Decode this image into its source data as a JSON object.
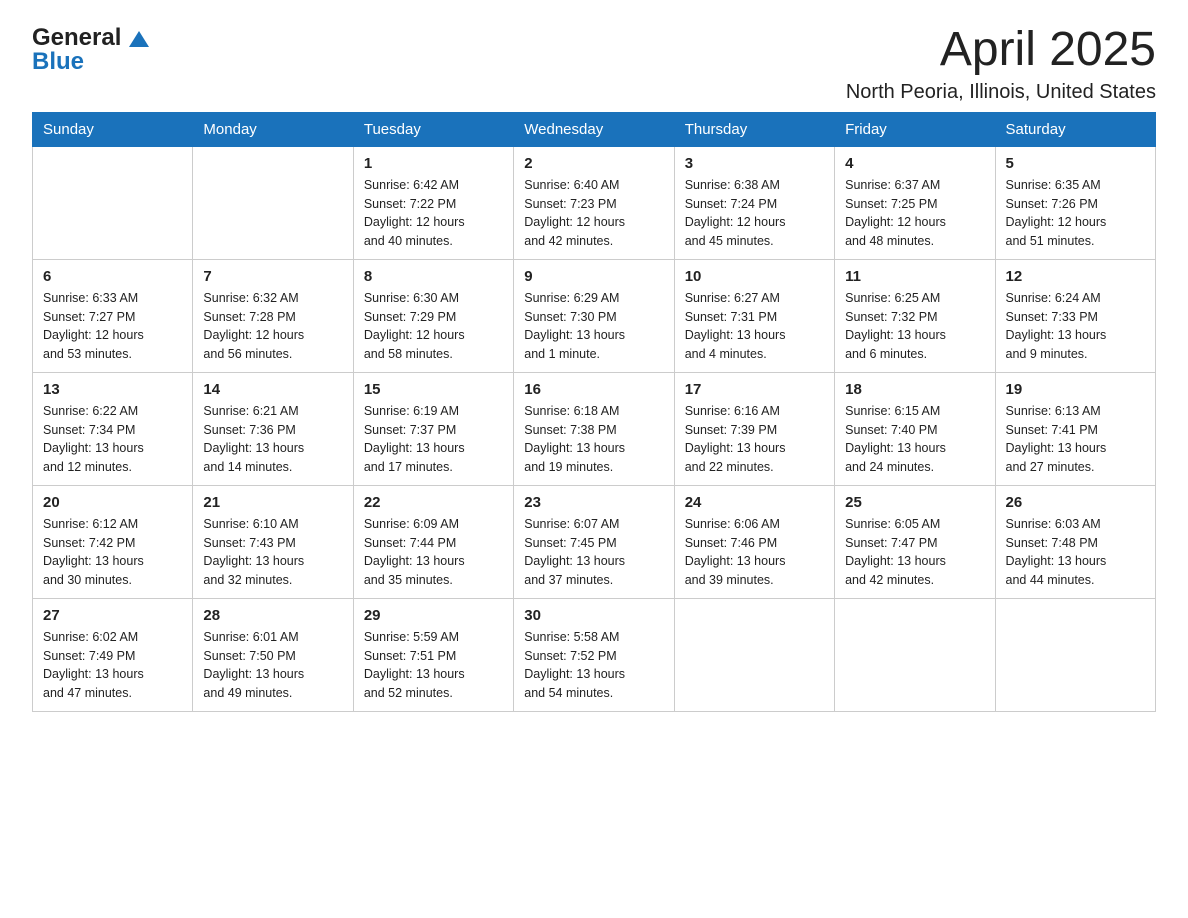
{
  "header": {
    "logo_text_general": "General",
    "logo_text_blue": "Blue",
    "month_title": "April 2025",
    "location": "North Peoria, Illinois, United States"
  },
  "calendar": {
    "days_of_week": [
      "Sunday",
      "Monday",
      "Tuesday",
      "Wednesday",
      "Thursday",
      "Friday",
      "Saturday"
    ],
    "weeks": [
      [
        {
          "day": "",
          "info": ""
        },
        {
          "day": "",
          "info": ""
        },
        {
          "day": "1",
          "info": "Sunrise: 6:42 AM\nSunset: 7:22 PM\nDaylight: 12 hours\nand 40 minutes."
        },
        {
          "day": "2",
          "info": "Sunrise: 6:40 AM\nSunset: 7:23 PM\nDaylight: 12 hours\nand 42 minutes."
        },
        {
          "day": "3",
          "info": "Sunrise: 6:38 AM\nSunset: 7:24 PM\nDaylight: 12 hours\nand 45 minutes."
        },
        {
          "day": "4",
          "info": "Sunrise: 6:37 AM\nSunset: 7:25 PM\nDaylight: 12 hours\nand 48 minutes."
        },
        {
          "day": "5",
          "info": "Sunrise: 6:35 AM\nSunset: 7:26 PM\nDaylight: 12 hours\nand 51 minutes."
        }
      ],
      [
        {
          "day": "6",
          "info": "Sunrise: 6:33 AM\nSunset: 7:27 PM\nDaylight: 12 hours\nand 53 minutes."
        },
        {
          "day": "7",
          "info": "Sunrise: 6:32 AM\nSunset: 7:28 PM\nDaylight: 12 hours\nand 56 minutes."
        },
        {
          "day": "8",
          "info": "Sunrise: 6:30 AM\nSunset: 7:29 PM\nDaylight: 12 hours\nand 58 minutes."
        },
        {
          "day": "9",
          "info": "Sunrise: 6:29 AM\nSunset: 7:30 PM\nDaylight: 13 hours\nand 1 minute."
        },
        {
          "day": "10",
          "info": "Sunrise: 6:27 AM\nSunset: 7:31 PM\nDaylight: 13 hours\nand 4 minutes."
        },
        {
          "day": "11",
          "info": "Sunrise: 6:25 AM\nSunset: 7:32 PM\nDaylight: 13 hours\nand 6 minutes."
        },
        {
          "day": "12",
          "info": "Sunrise: 6:24 AM\nSunset: 7:33 PM\nDaylight: 13 hours\nand 9 minutes."
        }
      ],
      [
        {
          "day": "13",
          "info": "Sunrise: 6:22 AM\nSunset: 7:34 PM\nDaylight: 13 hours\nand 12 minutes."
        },
        {
          "day": "14",
          "info": "Sunrise: 6:21 AM\nSunset: 7:36 PM\nDaylight: 13 hours\nand 14 minutes."
        },
        {
          "day": "15",
          "info": "Sunrise: 6:19 AM\nSunset: 7:37 PM\nDaylight: 13 hours\nand 17 minutes."
        },
        {
          "day": "16",
          "info": "Sunrise: 6:18 AM\nSunset: 7:38 PM\nDaylight: 13 hours\nand 19 minutes."
        },
        {
          "day": "17",
          "info": "Sunrise: 6:16 AM\nSunset: 7:39 PM\nDaylight: 13 hours\nand 22 minutes."
        },
        {
          "day": "18",
          "info": "Sunrise: 6:15 AM\nSunset: 7:40 PM\nDaylight: 13 hours\nand 24 minutes."
        },
        {
          "day": "19",
          "info": "Sunrise: 6:13 AM\nSunset: 7:41 PM\nDaylight: 13 hours\nand 27 minutes."
        }
      ],
      [
        {
          "day": "20",
          "info": "Sunrise: 6:12 AM\nSunset: 7:42 PM\nDaylight: 13 hours\nand 30 minutes."
        },
        {
          "day": "21",
          "info": "Sunrise: 6:10 AM\nSunset: 7:43 PM\nDaylight: 13 hours\nand 32 minutes."
        },
        {
          "day": "22",
          "info": "Sunrise: 6:09 AM\nSunset: 7:44 PM\nDaylight: 13 hours\nand 35 minutes."
        },
        {
          "day": "23",
          "info": "Sunrise: 6:07 AM\nSunset: 7:45 PM\nDaylight: 13 hours\nand 37 minutes."
        },
        {
          "day": "24",
          "info": "Sunrise: 6:06 AM\nSunset: 7:46 PM\nDaylight: 13 hours\nand 39 minutes."
        },
        {
          "day": "25",
          "info": "Sunrise: 6:05 AM\nSunset: 7:47 PM\nDaylight: 13 hours\nand 42 minutes."
        },
        {
          "day": "26",
          "info": "Sunrise: 6:03 AM\nSunset: 7:48 PM\nDaylight: 13 hours\nand 44 minutes."
        }
      ],
      [
        {
          "day": "27",
          "info": "Sunrise: 6:02 AM\nSunset: 7:49 PM\nDaylight: 13 hours\nand 47 minutes."
        },
        {
          "day": "28",
          "info": "Sunrise: 6:01 AM\nSunset: 7:50 PM\nDaylight: 13 hours\nand 49 minutes."
        },
        {
          "day": "29",
          "info": "Sunrise: 5:59 AM\nSunset: 7:51 PM\nDaylight: 13 hours\nand 52 minutes."
        },
        {
          "day": "30",
          "info": "Sunrise: 5:58 AM\nSunset: 7:52 PM\nDaylight: 13 hours\nand 54 minutes."
        },
        {
          "day": "",
          "info": ""
        },
        {
          "day": "",
          "info": ""
        },
        {
          "day": "",
          "info": ""
        }
      ]
    ]
  }
}
